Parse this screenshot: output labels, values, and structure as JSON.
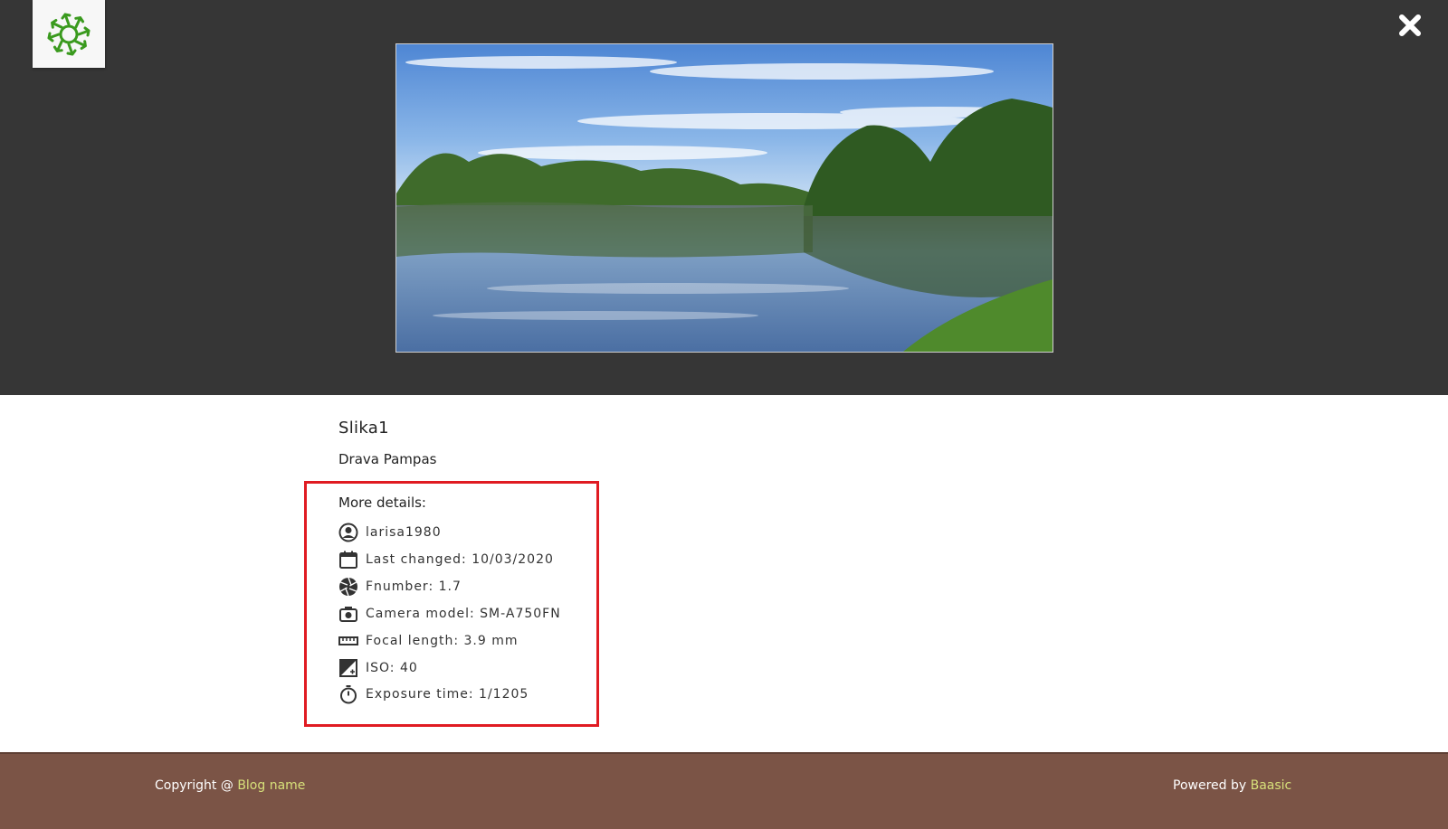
{
  "photo": {
    "title": "Slika1",
    "description": "Drava Pampas"
  },
  "details": {
    "heading": "More details:",
    "items": [
      {
        "icon": "user-icon",
        "text": "larisa1980"
      },
      {
        "icon": "calendar-icon",
        "text": "Last changed: 10/03/2020"
      },
      {
        "icon": "aperture-icon",
        "text": "Fnumber: 1.7"
      },
      {
        "icon": "camera-icon",
        "text": "Camera model: SM-A750FN"
      },
      {
        "icon": "ruler-icon",
        "text": "Focal length: 3.9 mm"
      },
      {
        "icon": "exposure-icon",
        "text": "ISO: 40"
      },
      {
        "icon": "stopwatch-icon",
        "text": "Exposure time: 1/1205"
      }
    ]
  },
  "footer": {
    "copyright_prefix": "Copyright @ ",
    "blog_link": "Blog name",
    "powered_prefix": "Powered by ",
    "powered_link": "Baasic"
  },
  "colors": {
    "header_bg": "#363636",
    "footer_bg": "#7b5446",
    "link": "#d7e07a",
    "highlight_border": "#e01b22",
    "logo_green": "#3a9a1e"
  }
}
